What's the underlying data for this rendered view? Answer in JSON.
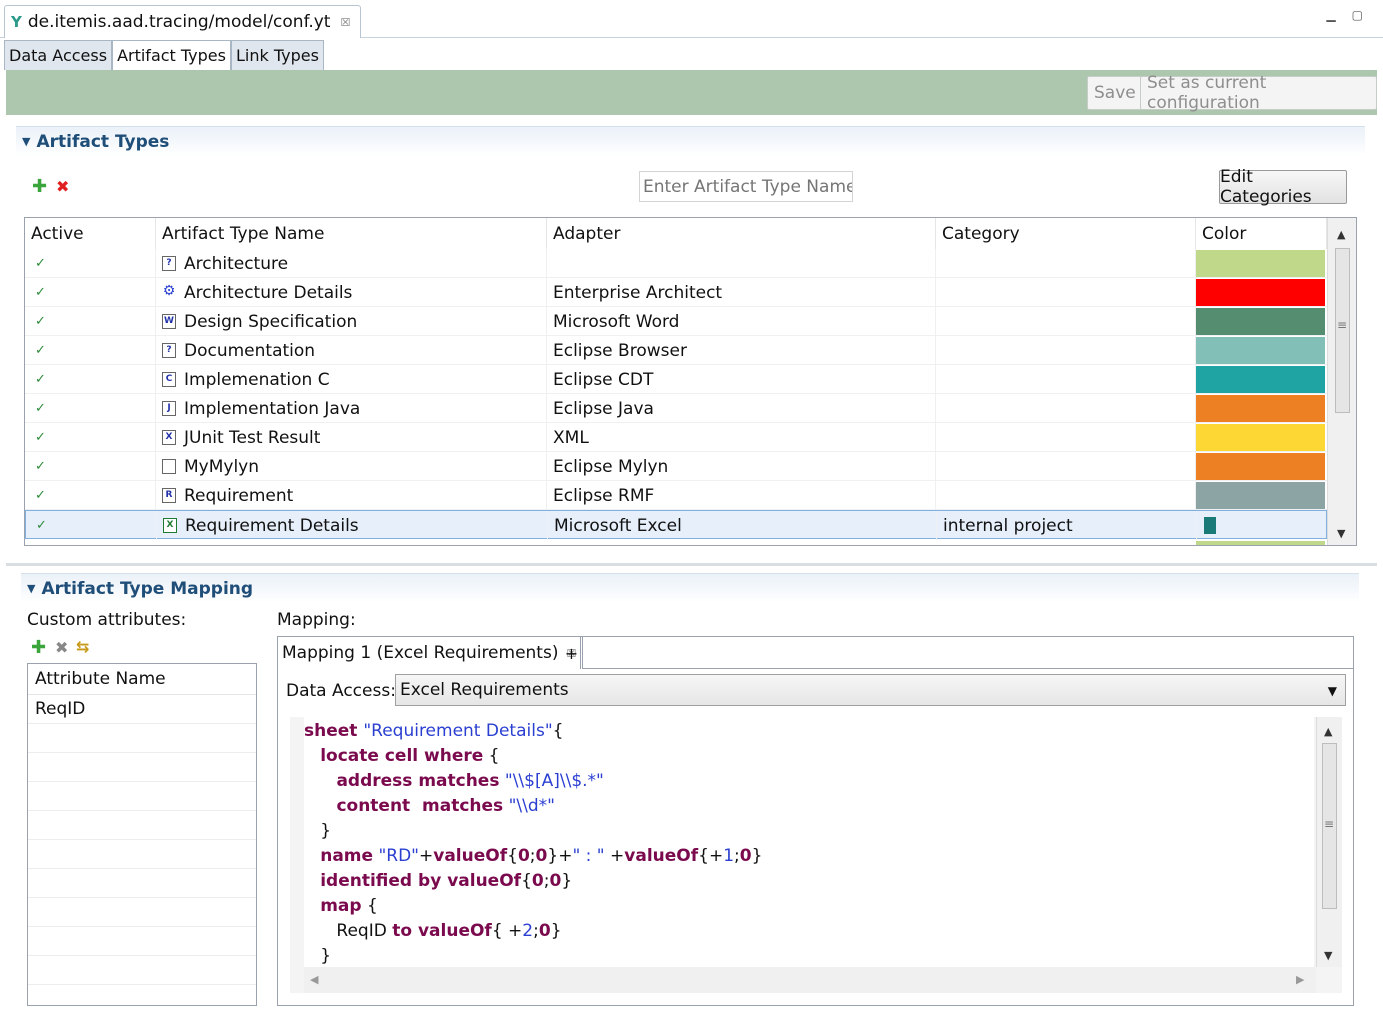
{
  "editor_tab": {
    "title": "de.itemis.aad.tracing/model/conf.yt",
    "close": "☒"
  },
  "window_controls": {
    "minimize": "▁",
    "maximize": "▢"
  },
  "page_tabs": [
    {
      "label": "Data Access"
    },
    {
      "label": "Artifact Types"
    },
    {
      "label": "Link Types"
    }
  ],
  "toolbar": {
    "save_label": "Save",
    "set_current_label": "Set as current configuration"
  },
  "artifact_section": {
    "title": "Artifact Types",
    "search_placeholder": "Enter Artifact Type Name...",
    "edit_categories_label": "Edit Categories",
    "columns": [
      "Active",
      "Artifact Type Name",
      "Adapter",
      "Category",
      "Color"
    ],
    "rows": [
      {
        "active": "✓",
        "icon": "html-file-icon",
        "glyph": "?",
        "name": "Architecture",
        "adapter": "",
        "category": "",
        "color": "#c0d88a"
      },
      {
        "active": "✓",
        "icon": "enterprise-architect-icon",
        "glyph": "⚙",
        "name": "Architecture Details",
        "adapter": "Enterprise Architect",
        "category": "",
        "color": "#ff0000"
      },
      {
        "active": "✓",
        "icon": "word-doc-icon",
        "glyph": "W",
        "name": "Design Specification",
        "adapter": "Microsoft Word",
        "category": "",
        "color": "#548d6f"
      },
      {
        "active": "✓",
        "icon": "html-file-icon",
        "glyph": "?",
        "name": "Documentation",
        "adapter": "Eclipse Browser",
        "category": "",
        "color": "#82bfb6"
      },
      {
        "active": "✓",
        "icon": "c-file-icon",
        "glyph": "C",
        "name": "Implemenation C",
        "adapter": "Eclipse CDT",
        "category": "",
        "color": "#20a3a3"
      },
      {
        "active": "✓",
        "icon": "java-file-icon",
        "glyph": "J",
        "name": "Implementation Java",
        "adapter": "Eclipse Java",
        "category": "",
        "color": "#ed8022"
      },
      {
        "active": "✓",
        "icon": "xml-file-icon",
        "glyph": "X",
        "name": "JUnit Test Result",
        "adapter": "XML",
        "category": "",
        "color": "#fdd835"
      },
      {
        "active": "✓",
        "icon": "blank-file-icon",
        "glyph": "",
        "name": "MyMylyn",
        "adapter": "Eclipse Mylyn",
        "category": "",
        "color": "#ed8022"
      },
      {
        "active": "✓",
        "icon": "rmf-file-icon",
        "glyph": "R",
        "name": "Requirement",
        "adapter": "Eclipse RMF",
        "category": "",
        "color": "#8da4a4"
      },
      {
        "active": "✓",
        "icon": "excel-file-icon",
        "glyph": "X",
        "name": "Requirement Details",
        "adapter": "Microsoft Excel",
        "category": "internal project",
        "color": "#1a7a78",
        "selected": true
      }
    ]
  },
  "mapping_section": {
    "title": "Artifact Type Mapping",
    "custom_attributes_label": "Custom attributes:",
    "attribute_column": "Attribute Name",
    "attributes": [
      "ReqID"
    ],
    "mapping_label": "Mapping:",
    "mapping_tab": "Mapping 1 (Excel Requirements)",
    "mapping_tab_close": "☒",
    "add_tab": "+",
    "data_access_label": "Data Access:",
    "data_access_value": "Excel Requirements",
    "code_lines": [
      [
        {
          "t": "kw",
          "v": "sheet "
        },
        {
          "t": "str",
          "v": "\"Requirement Details\""
        },
        {
          "t": "pl",
          "v": "{"
        }
      ],
      [
        {
          "t": "pl",
          "v": "   "
        },
        {
          "t": "kw",
          "v": "locate cell where"
        },
        {
          "t": "pl",
          "v": " {"
        }
      ],
      [
        {
          "t": "pl",
          "v": "      "
        },
        {
          "t": "kw",
          "v": "address matches"
        },
        {
          "t": "pl",
          "v": " "
        },
        {
          "t": "str",
          "v": "\"\\\\$[A]\\\\$.*\""
        }
      ],
      [
        {
          "t": "pl",
          "v": "      "
        },
        {
          "t": "kw",
          "v": "content  matches"
        },
        {
          "t": "pl",
          "v": " "
        },
        {
          "t": "str",
          "v": "\"\\\\d*\""
        }
      ],
      [
        {
          "t": "pl",
          "v": "   }"
        }
      ],
      [
        {
          "t": "pl",
          "v": "   "
        },
        {
          "t": "kw",
          "v": "name"
        },
        {
          "t": "pl",
          "v": " "
        },
        {
          "t": "str",
          "v": "\"RD\""
        },
        {
          "t": "pl",
          "v": "+"
        },
        {
          "t": "kw",
          "v": "valueOf"
        },
        {
          "t": "pl",
          "v": "{"
        },
        {
          "t": "kw",
          "v": "0"
        },
        {
          "t": "pl",
          "v": ";"
        },
        {
          "t": "kw",
          "v": "0"
        },
        {
          "t": "pl",
          "v": "}+"
        },
        {
          "t": "str",
          "v": "\" : \""
        },
        {
          "t": "pl",
          "v": " +"
        },
        {
          "t": "kw",
          "v": "valueOf"
        },
        {
          "t": "pl",
          "v": "{+"
        },
        {
          "t": "num",
          "v": "1"
        },
        {
          "t": "pl",
          "v": ";"
        },
        {
          "t": "kw",
          "v": "0"
        },
        {
          "t": "pl",
          "v": "}"
        }
      ],
      [
        {
          "t": "pl",
          "v": "   "
        },
        {
          "t": "kw",
          "v": "identified by valueOf"
        },
        {
          "t": "pl",
          "v": "{"
        },
        {
          "t": "kw",
          "v": "0"
        },
        {
          "t": "pl",
          "v": ";"
        },
        {
          "t": "kw",
          "v": "0"
        },
        {
          "t": "pl",
          "v": "}"
        }
      ],
      [
        {
          "t": "pl",
          "v": "   "
        },
        {
          "t": "kw",
          "v": "map"
        },
        {
          "t": "pl",
          "v": " {"
        }
      ],
      [
        {
          "t": "pl",
          "v": "      ReqID "
        },
        {
          "t": "kw",
          "v": "to valueOf"
        },
        {
          "t": "pl",
          "v": "{ +"
        },
        {
          "t": "num",
          "v": "2"
        },
        {
          "t": "pl",
          "v": ";"
        },
        {
          "t": "kw",
          "v": "0"
        },
        {
          "t": "pl",
          "v": "}"
        }
      ],
      [
        {
          "t": "pl",
          "v": "   }"
        }
      ]
    ]
  },
  "icons": {
    "add": "✚",
    "delete": "✖",
    "delete_gray": "✖",
    "swap": "⇆",
    "twistie": "▼",
    "scroll_up": "▲",
    "scroll_down": "▼",
    "scroll_left": "◀",
    "scroll_right": "▶",
    "dropdown": "▼",
    "grip": "≡",
    "app": "Y"
  }
}
